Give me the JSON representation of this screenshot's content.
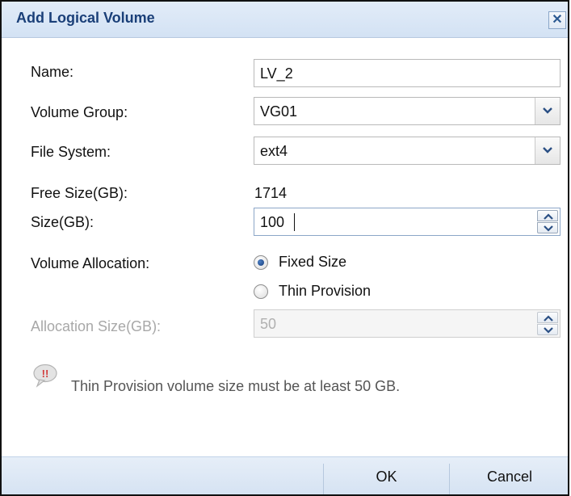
{
  "dialog": {
    "title": "Add Logical Volume",
    "close_glyph": "✕"
  },
  "form": {
    "name_label": "Name:",
    "name_value": "LV_2",
    "volume_group_label": "Volume Group:",
    "volume_group_value": "VG01",
    "file_system_label": "File System:",
    "file_system_value": "ext4",
    "free_size_label": "Free Size(GB):",
    "free_size_value": "1714",
    "size_label": "Size(GB):",
    "size_value": "100",
    "allocation_label": "Volume Allocation:",
    "allocation_options": [
      {
        "label": "Fixed Size",
        "selected": true
      },
      {
        "label": "Thin Provision",
        "selected": false
      }
    ],
    "allocation_size_label": "Allocation Size(GB):",
    "allocation_size_value": "50"
  },
  "notice": {
    "icon": "warning-bubble-icon",
    "icon_text": "!!",
    "text": "Thin Provision volume size must be at least 50 GB."
  },
  "buttons": {
    "ok": "OK",
    "cancel": "Cancel"
  },
  "colors": {
    "title": "#1a3f78",
    "titlebar": "#d3e2f4",
    "disabled_text": "#a8a8a8",
    "radio_selected": "#183d7a"
  }
}
